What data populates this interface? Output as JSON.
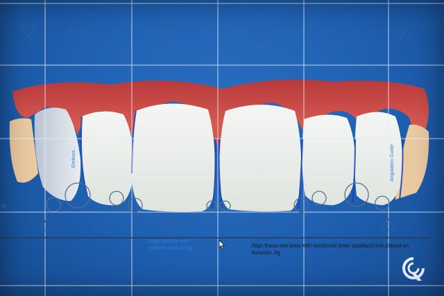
{
  "left_edge_label": "ge",
  "left_tooth_label": "Emboss...",
  "right_tooth_label": "Angulation Guide",
  "midline_caption": "Align Midline with midline mark on jig",
  "align_caption": "Align these two lines with horizontal (inter pupillary) line placed on Assavior Jig",
  "logo_icon": "rotate-logo-icon",
  "colors": {
    "background": "#1e5fb0",
    "gingiva": "#c94a45",
    "tooth": "#eaeeea",
    "guide_line": "#e6ecf5",
    "marker": "#2b5f9e"
  }
}
